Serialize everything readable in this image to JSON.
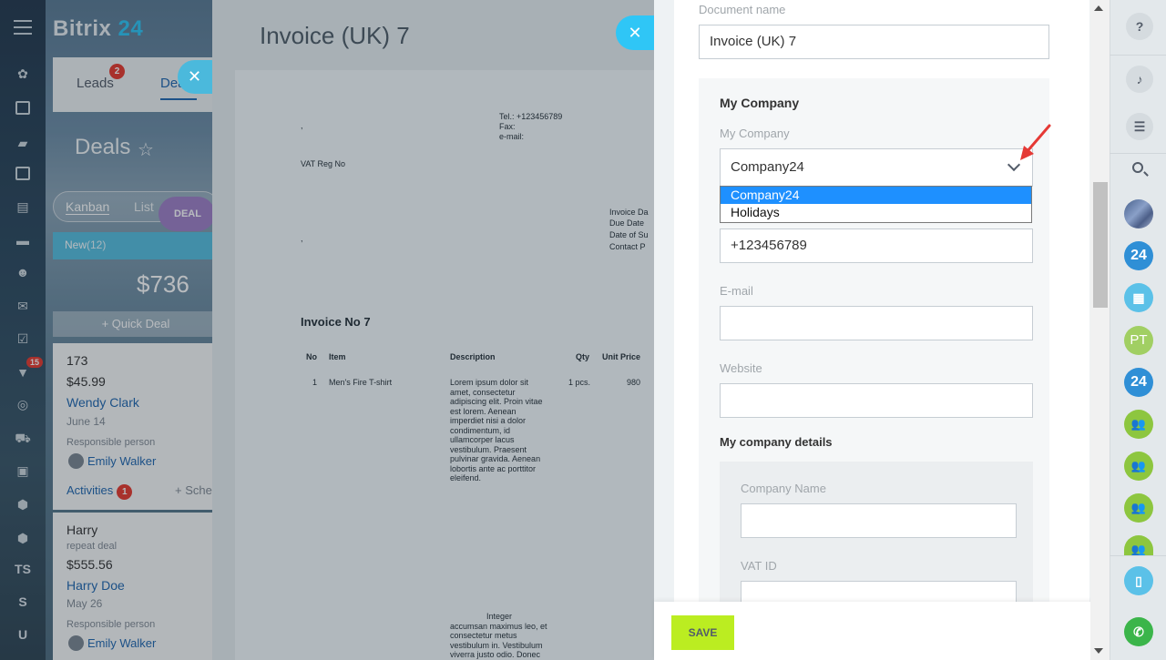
{
  "app": {
    "brand_prefix": "Bitrix",
    "brand_suffix": "24"
  },
  "left_nav": {
    "badge": "15",
    "text_items": [
      "TS",
      "S",
      "U"
    ],
    "icons": [
      "apps-icon",
      "feed-icon",
      "chat-icon",
      "calendar-icon",
      "documents-icon",
      "drive-icon",
      "contacts-icon",
      "mail-icon",
      "tasks-icon",
      "crm-filter-icon",
      "target-icon",
      "shop-icon",
      "contact-card-icon",
      "box-icon",
      "box2-icon"
    ]
  },
  "crm": {
    "tabs": [
      {
        "label": "Leads",
        "badge": "2"
      },
      {
        "label": "Deals"
      }
    ],
    "title": "Deals",
    "views": {
      "kanban": "Kanban",
      "list": "List"
    },
    "deal_button": "DEAL",
    "stage": {
      "name": "New",
      "count": "(12)",
      "sum": "$736",
      "quick_deal": "+ Quick Deal"
    },
    "cards": [
      {
        "title": "173",
        "amount": "$45.99",
        "client": "Wendy Clark",
        "date": "June 14",
        "responsible_label": "Responsible person",
        "responsible": "Emily Walker",
        "activities": "Activities",
        "activities_badge": "1",
        "schedule": "+ Sche"
      },
      {
        "title": "Harry",
        "subtitle": "repeat deal",
        "amount": "$555.56",
        "client": "Harry Doe",
        "date": "May 26",
        "responsible_label": "Responsible person",
        "responsible": "Emily Walker"
      }
    ]
  },
  "preview": {
    "title": "Invoice (UK) 7",
    "doc": {
      "comma1": ",",
      "tel": "Tel.: +123456789",
      "fax": "Fax:",
      "email": "e-mail:",
      "vat": "VAT Reg No",
      "comma2": ",",
      "invoice_date": "Invoice Da",
      "due_date": "Due Date",
      "date_of_supply": "Date of Su",
      "contact": "Contact P",
      "invoice_no": "Invoice No 7",
      "headers": {
        "no": "No",
        "item": "Item",
        "description": "Description",
        "qty": "Qty",
        "unit_price": "Unit Price"
      },
      "row": {
        "no": "1",
        "item": "Men's Fire T-shirt",
        "qty": "1 pcs.",
        "price": "980"
      },
      "desc_lines": [
        "Lorem ipsum dolor sit",
        "amet, consectetur",
        "adipiscing elit. Proin vitae",
        "est lorem. Aenean",
        "imperdiet nisi a dolor",
        "condimentum, id",
        "ullamcorper lacus",
        "vestibulum. Praesent",
        "pulvinar gravida. Aenean",
        "lobortis ante ac porttitor",
        "eleifend."
      ],
      "desc2_lines": [
        "Integer",
        "accumsan maximus leo, et",
        "consectetur metus",
        "vestibulum in. Vestibulum",
        "viverra justo odio. Donec"
      ]
    }
  },
  "form": {
    "document_name_label": "Document name",
    "document_name_value": "Invoice (UK) 7",
    "section_title": "My Company",
    "company_label": "My Company",
    "company_value": "Company24",
    "dropdown_options": [
      "Company24",
      "Holidays"
    ],
    "phone_value": "+123456789",
    "email_label": "E-mail",
    "website_label": "Website",
    "details_title": "My company details",
    "company_name_label": "Company Name",
    "vat_id_label": "VAT ID",
    "save_label": "SAVE"
  },
  "right_rail": {
    "initials": "PT",
    "badge_24": "24"
  },
  "colors": {
    "accent": "#2fc6f6",
    "save": "#bbed21",
    "selected": "#1e90ff",
    "badge": "#e83a2f"
  }
}
